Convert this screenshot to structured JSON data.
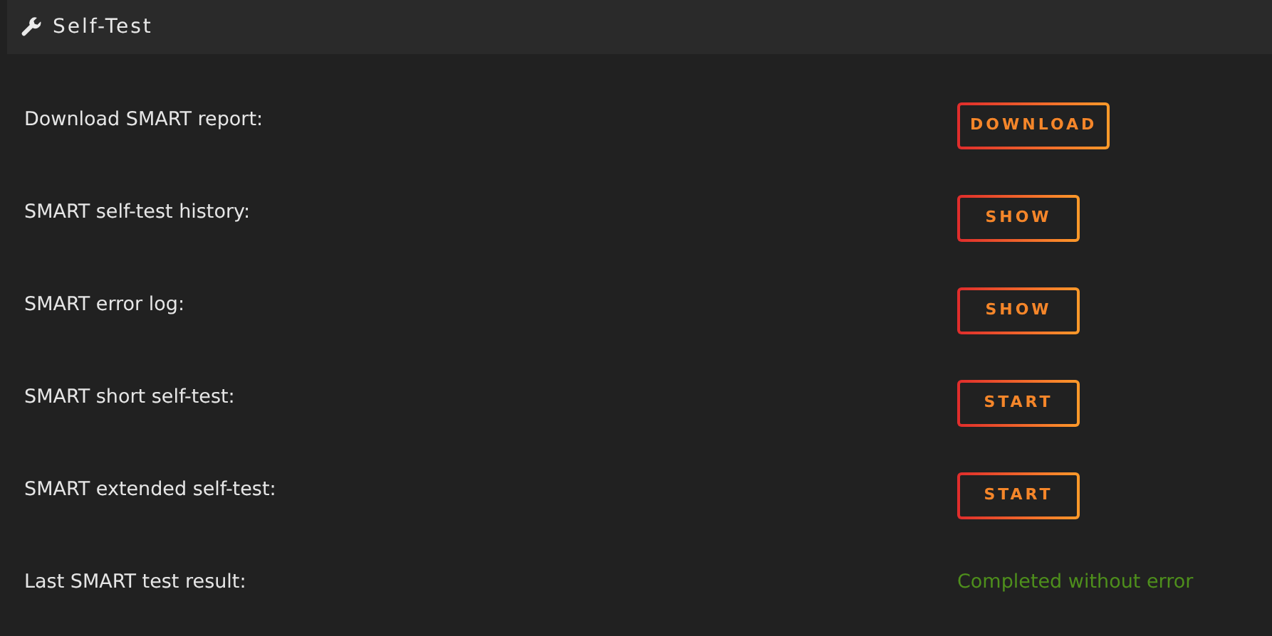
{
  "panel": {
    "title": "Self-Test"
  },
  "rows": [
    {
      "kind": "button",
      "label": "Download SMART report:",
      "action": "DOWNLOAD"
    },
    {
      "kind": "button",
      "label": "SMART self-test history:",
      "action": "SHOW"
    },
    {
      "kind": "button",
      "label": "SMART error log:",
      "action": "SHOW"
    },
    {
      "kind": "button",
      "label": "SMART short self-test:",
      "action": "START"
    },
    {
      "kind": "button",
      "label": "SMART extended self-test:",
      "action": "START"
    },
    {
      "kind": "status",
      "label": "Last SMART test result:",
      "value": "Completed without error"
    }
  ]
}
